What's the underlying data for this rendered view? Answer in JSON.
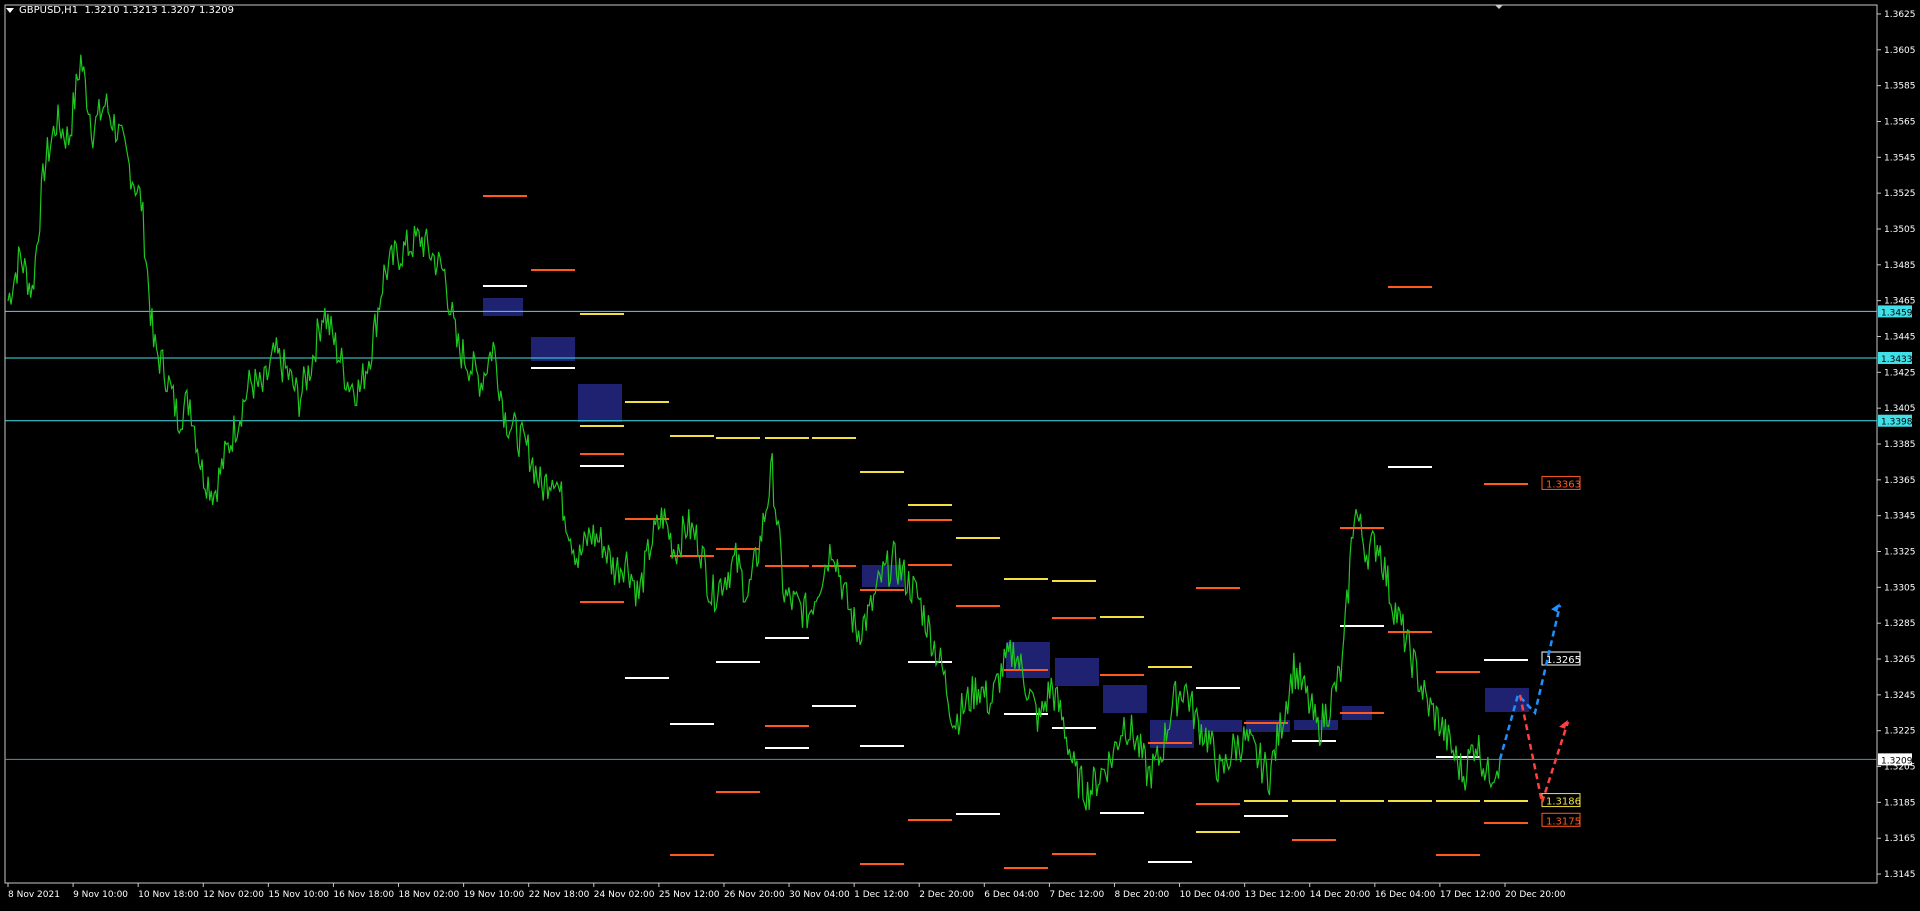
{
  "header": {
    "symbol": "GBPUSD,H1",
    "quote": "1.3210 1.3213 1.3207 1.3209"
  },
  "colors": {
    "background": "#000000",
    "price": "#1fc81f",
    "frame": "#c8c8c8",
    "resistance": "#3fe0e8",
    "current": "#5a8fb0",
    "zone": "#1e2270",
    "level_white": "#ffffff",
    "level_yellow": "#f0e040",
    "level_orange": "#ff5a1e",
    "arrow_blue": "#1e90ff",
    "arrow_red": "#ff4040"
  },
  "chart_data": {
    "type": "line",
    "title": "",
    "xlabel": "",
    "ylabel": "",
    "ylim": [
      1.314,
      1.363
    ],
    "grid": false,
    "y_ticks": [
      "1.3625",
      "1.3605",
      "1.3585",
      "1.3565",
      "1.3545",
      "1.3525",
      "1.3505",
      "1.3485",
      "1.3465",
      "1.3445",
      "1.3425",
      "1.3405",
      "1.3385",
      "1.3365",
      "1.3345",
      "1.3325",
      "1.3305",
      "1.3285",
      "1.3265",
      "1.3245",
      "1.3225",
      "1.3205",
      "1.3185",
      "1.3165",
      "1.3145"
    ],
    "x_ticks": [
      "8 Nov 2021",
      "9 Nov 10:00",
      "10 Nov 18:00",
      "12 Nov 02:00",
      "15 Nov 10:00",
      "16 Nov 18:00",
      "18 Nov 02:00",
      "19 Nov 10:00",
      "22 Nov 18:00",
      "24 Nov 02:00",
      "25 Nov 12:00",
      "26 Nov 20:00",
      "30 Nov 04:00",
      "1 Dec 12:00",
      "2 Dec 20:00",
      "6 Dec 04:00",
      "7 Dec 12:00",
      "8 Dec 20:00",
      "10 Dec 04:00",
      "13 Dec 12:00",
      "14 Dec 20:00",
      "16 Dec 04:00",
      "17 Dec 12:00",
      "20 Dec 20:00"
    ],
    "series": [
      {
        "values": [
          1.3465,
          1.349,
          1.347,
          1.354,
          1.3565,
          1.3555,
          1.36,
          1.356,
          1.3575,
          1.356,
          1.354,
          1.352,
          1.344,
          1.3425,
          1.34,
          1.341,
          1.337,
          1.3358,
          1.338,
          1.34,
          1.342,
          1.3415,
          1.3435,
          1.3425,
          1.341,
          1.343,
          1.346,
          1.344,
          1.342,
          1.3415,
          1.344,
          1.348,
          1.349,
          1.3495,
          1.35,
          1.349,
          1.348,
          1.344,
          1.343,
          1.342,
          1.344,
          1.34,
          1.339,
          1.338,
          1.336,
          1.337,
          1.3345,
          1.332,
          1.3335,
          1.333,
          1.3315,
          1.332,
          1.33,
          1.333,
          1.3345,
          1.3325,
          1.334,
          1.333,
          1.33,
          1.331,
          1.332,
          1.33,
          1.333,
          1.337,
          1.33,
          1.3295,
          1.329,
          1.331,
          1.333,
          1.33,
          1.328,
          1.329,
          1.331,
          1.332,
          1.331,
          1.33,
          1.328,
          1.326,
          1.323,
          1.324,
          1.325,
          1.324,
          1.326,
          1.327,
          1.325,
          1.323,
          1.325,
          1.323,
          1.32,
          1.319,
          1.32,
          1.321,
          1.323,
          1.322,
          1.32,
          1.321,
          1.324,
          1.325,
          1.323,
          1.322,
          1.32,
          1.3215,
          1.322,
          1.321,
          1.32,
          1.323,
          1.326,
          1.3245,
          1.3225,
          1.324,
          1.326,
          1.335,
          1.3325,
          1.333,
          1.33,
          1.328,
          1.326,
          1.324,
          1.323,
          1.3215,
          1.32,
          1.322,
          1.32,
          1.3209
        ]
      }
    ],
    "horizontal_lines": [
      {
        "value": 1.3459,
        "label": "1.3459",
        "style": "resistance"
      },
      {
        "value": 1.3433,
        "label": "1.3433",
        "style": "resistance"
      },
      {
        "value": 1.3398,
        "label": "1.3398",
        "style": "resistance"
      },
      {
        "value": 1.3209,
        "label": "1.3209",
        "style": "current"
      }
    ],
    "price_tags": [
      {
        "value": 1.3363,
        "label": "1.3363",
        "style": "orange"
      },
      {
        "value": 1.3265,
        "label": "1.3265",
        "style": "white"
      },
      {
        "value": 1.3186,
        "label": "1.3186",
        "style": "yellow"
      },
      {
        "value": 1.3175,
        "label": "1.3175",
        "style": "orange"
      }
    ],
    "annotations": [
      {
        "type": "arrow",
        "color": "blue",
        "from": "20 Dec 20:00",
        "to": "after 20 Dec",
        "target": 1.3295
      },
      {
        "type": "arrow",
        "color": "red",
        "from": "20 Dec 20:00",
        "to": "after 20 Dec",
        "target": 1.323
      }
    ]
  }
}
